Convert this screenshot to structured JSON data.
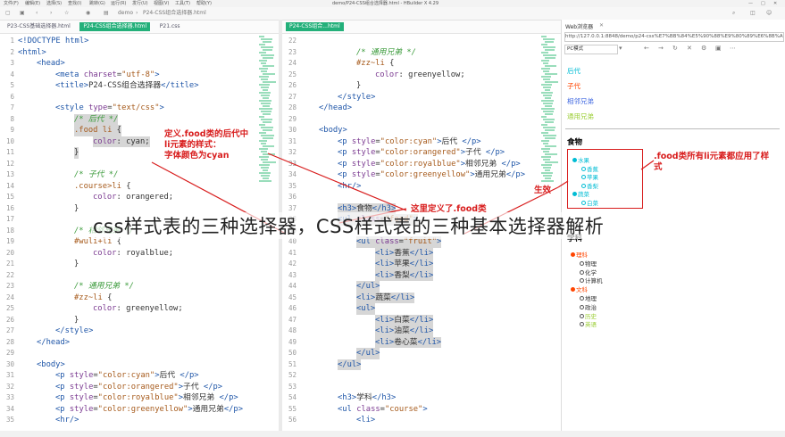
{
  "window": {
    "menu": [
      "文件(F)",
      "编辑(E)",
      "选择(S)",
      "查找(I)",
      "跳转(G)",
      "运行(R)",
      "发行(U)",
      "视图(V)",
      "工具(T)",
      "帮助(Y)"
    ],
    "title": "demo/P24-CSS组合选择器.html - HBuilder X 4.29"
  },
  "toolbar": {
    "breadcrumb_root": "demo",
    "breadcrumb_file": "P24-CSS组合选择器.html"
  },
  "tabs_left": [
    {
      "label": "P23-CSS基础选择器.html",
      "active": false
    },
    {
      "label": "P24-CSS组合选择器.html",
      "active": true
    },
    {
      "label": "P21.css",
      "active": false
    }
  ],
  "tabs_right": [
    {
      "label": "P24-CSS组合...html",
      "active": true
    }
  ],
  "left_code": [
    {
      "n": "1",
      "html": "<span class=\"tg\">&lt;!DOCTYPE html&gt;</span>",
      "ind": 0
    },
    {
      "n": "2",
      "html": "<span class=\"tg\">&lt;html&gt;</span>",
      "ind": 0
    },
    {
      "n": "3",
      "html": "<span class=\"tg\">&lt;head&gt;</span>",
      "ind": 1
    },
    {
      "n": "4",
      "html": "<span class=\"tg\">&lt;meta</span> <span class=\"at\">charset</span>=<span class=\"sv\">\"utf-8\"</span><span class=\"tg\">&gt;</span>",
      "ind": 2
    },
    {
      "n": "5",
      "html": "<span class=\"tg\">&lt;title&gt;</span>P24-CSS组合选择器<span class=\"tg\">&lt;/title&gt;</span>",
      "ind": 2
    },
    {
      "n": "6",
      "html": "",
      "ind": 0
    },
    {
      "n": "7",
      "html": "<span class=\"tg\">&lt;style</span> <span class=\"at\">type</span>=<span class=\"sv\">\"text/css\"</span><span class=\"tg\">&gt;</span>",
      "ind": 2
    },
    {
      "n": "8",
      "html": "<span class=\"cm\">/* 后代 */</span>",
      "ind": 3
    },
    {
      "n": "9",
      "html": "<span class=\"sv\">.food li</span> {",
      "ind": 3
    },
    {
      "n": "10",
      "html": "<span class=\"at\">color</span>: cyan;",
      "ind": 4
    },
    {
      "n": "11",
      "html": "}",
      "ind": 3
    },
    {
      "n": "12",
      "html": "",
      "ind": 0
    },
    {
      "n": "13",
      "html": "<span class=\"cm\">/* 子代 */</span>",
      "ind": 3
    },
    {
      "n": "14",
      "html": "<span class=\"sv\">.course&gt;li</span> {",
      "ind": 3
    },
    {
      "n": "15",
      "html": "<span class=\"at\">color</span>: orangered;",
      "ind": 4
    },
    {
      "n": "16",
      "html": "}",
      "ind": 3
    },
    {
      "n": "17",
      "html": "",
      "ind": 0
    },
    {
      "n": "18",
      "html": "<span class=\"cm\">/* 相邻兄弟 */</span>",
      "ind": 3
    },
    {
      "n": "19",
      "html": "<span class=\"sv\">#wuli+li</span> {",
      "ind": 3
    },
    {
      "n": "20",
      "html": "<span class=\"at\">color</span>: royalblue;",
      "ind": 4
    },
    {
      "n": "21",
      "html": "}",
      "ind": 3
    },
    {
      "n": "22",
      "html": "",
      "ind": 0
    },
    {
      "n": "23",
      "html": "<span class=\"cm\">/* 通用兄弟 */</span>",
      "ind": 3
    },
    {
      "n": "24",
      "html": "<span class=\"sv\">#zz~li</span> {",
      "ind": 3
    },
    {
      "n": "25",
      "html": "<span class=\"at\">color</span>: greenyellow;",
      "ind": 4
    },
    {
      "n": "26",
      "html": "}",
      "ind": 3
    },
    {
      "n": "27",
      "html": "<span class=\"tg\">&lt;/style&gt;</span>",
      "ind": 2
    },
    {
      "n": "28",
      "html": "<span class=\"tg\">&lt;/head&gt;</span>",
      "ind": 1
    },
    {
      "n": "29",
      "html": "",
      "ind": 0
    },
    {
      "n": "30",
      "html": "<span class=\"tg\">&lt;body&gt;</span>",
      "ind": 1
    },
    {
      "n": "31",
      "html": "<span class=\"tg\">&lt;p</span> <span class=\"at\">style</span>=<span class=\"sv\">\"color:cyan\"</span><span class=\"tg\">&gt;</span>后代 <span class=\"tg\">&lt;/p&gt;</span>",
      "ind": 2
    },
    {
      "n": "32",
      "html": "<span class=\"tg\">&lt;p</span> <span class=\"at\">style</span>=<span class=\"sv\">\"color:orangered\"</span><span class=\"tg\">&gt;</span>子代 <span class=\"tg\">&lt;/p&gt;</span>",
      "ind": 2
    },
    {
      "n": "33",
      "html": "<span class=\"tg\">&lt;p</span> <span class=\"at\">style</span>=<span class=\"sv\">\"color:royalblue\"</span><span class=\"tg\">&gt;</span>相邻兄弟 <span class=\"tg\">&lt;/p&gt;</span>",
      "ind": 2
    },
    {
      "n": "34",
      "html": "<span class=\"tg\">&lt;p</span> <span class=\"at\">style</span>=<span class=\"sv\">\"color:greenyellow\"</span><span class=\"tg\">&gt;</span>通用兄弟<span class=\"tg\">&lt;/p&gt;</span>",
      "ind": 2
    },
    {
      "n": "35",
      "html": "<span class=\"tg\">&lt;hr/&gt;</span>",
      "ind": 2
    }
  ],
  "right_code": [
    {
      "n": "22",
      "html": "",
      "ind": 0
    },
    {
      "n": "23",
      "html": "<span class=\"cm\">/* 通用兄弟 */</span>",
      "ind": 3
    },
    {
      "n": "24",
      "html": "<span class=\"sv\">#zz~li</span> {",
      "ind": 3
    },
    {
      "n": "25",
      "html": "<span class=\"at\">color</span>: greenyellow;",
      "ind": 4
    },
    {
      "n": "26",
      "html": "}",
      "ind": 3
    },
    {
      "n": "27",
      "html": "<span class=\"tg\">&lt;/style&gt;</span>",
      "ind": 2
    },
    {
      "n": "28",
      "html": "<span class=\"tg\">&lt;/head&gt;</span>",
      "ind": 1
    },
    {
      "n": "29",
      "html": "",
      "ind": 0
    },
    {
      "n": "30",
      "html": "<span class=\"tg\">&lt;body&gt;</span>",
      "ind": 1
    },
    {
      "n": "31",
      "html": "<span class=\"tg\">&lt;p</span> <span class=\"at\">style</span>=<span class=\"sv\">\"color:cyan\"</span><span class=\"tg\">&gt;</span>后代 <span class=\"tg\">&lt;/p&gt;</span>",
      "ind": 2
    },
    {
      "n": "32",
      "html": "<span class=\"tg\">&lt;p</span> <span class=\"at\">style</span>=<span class=\"sv\">\"color:orangered\"</span><span class=\"tg\">&gt;</span>子代 <span class=\"tg\">&lt;/p&gt;</span>",
      "ind": 2
    },
    {
      "n": "33",
      "html": "<span class=\"tg\">&lt;p</span> <span class=\"at\">style</span>=<span class=\"sv\">\"color:royalblue\"</span><span class=\"tg\">&gt;</span>相邻兄弟 <span class=\"tg\">&lt;/p&gt;</span>",
      "ind": 2
    },
    {
      "n": "34",
      "html": "<span class=\"tg\">&lt;p</span> <span class=\"at\">style</span>=<span class=\"sv\">\"color:greenyellow\"</span><span class=\"tg\">&gt;</span>通用兄弟<span class=\"tg\">&lt;/p&gt;</span>",
      "ind": 2
    },
    {
      "n": "35",
      "html": "<span class=\"tg\">&lt;hr/&gt;</span>",
      "ind": 2
    },
    {
      "n": "36",
      "html": "",
      "ind": 0
    },
    {
      "n": "37",
      "html": "<span class=\"tg\">&lt;h3&gt;</span>食物<span class=\"tg\">&lt;/h3&gt;</span>",
      "ind": 2
    },
    {
      "n": "38",
      "html": "<span class=\"tg\">&lt;ul</span> <span class=\"at\">class</span>=<span class=\"sv\">\"food\"</span><span class=\"tg\">&gt;</span>",
      "ind": 2
    },
    {
      "n": "39",
      "html": "",
      "ind": 0
    },
    {
      "n": "40",
      "html": "<span class=\"tg\">&lt;ul</span> <span class=\"at\">class</span>=<span class=\"sv\">\"fruit\"</span><span class=\"tg\">&gt;</span>",
      "ind": 3
    },
    {
      "n": "41",
      "html": "<span class=\"tg\">&lt;li&gt;</span>香蕉<span class=\"tg\">&lt;/li&gt;</span>",
      "ind": 4
    },
    {
      "n": "42",
      "html": "<span class=\"tg\">&lt;li&gt;</span>苹果<span class=\"tg\">&lt;/li&gt;</span>",
      "ind": 4
    },
    {
      "n": "43",
      "html": "<span class=\"tg\">&lt;li&gt;</span>香梨<span class=\"tg\">&lt;/li&gt;</span>",
      "ind": 4
    },
    {
      "n": "44",
      "html": "<span class=\"tg\">&lt;/ul&gt;</span>",
      "ind": 3
    },
    {
      "n": "45",
      "html": "<span class=\"tg\">&lt;li&gt;</span>蔬菜<span class=\"tg\">&lt;/li&gt;</span>",
      "ind": 3
    },
    {
      "n": "46",
      "html": "<span class=\"tg\">&lt;ul&gt;</span>",
      "ind": 3
    },
    {
      "n": "47",
      "html": "<span class=\"tg\">&lt;li&gt;</span>白菜<span class=\"tg\">&lt;/li&gt;</span>",
      "ind": 4
    },
    {
      "n": "48",
      "html": "<span class=\"tg\">&lt;li&gt;</span>油菜<span class=\"tg\">&lt;/li&gt;</span>",
      "ind": 4
    },
    {
      "n": "49",
      "html": "<span class=\"tg\">&lt;li&gt;</span>卷心菜<span class=\"tg\">&lt;/li&gt;</span>",
      "ind": 4
    },
    {
      "n": "50",
      "html": "<span class=\"tg\">&lt;/ul&gt;</span>",
      "ind": 3
    },
    {
      "n": "51",
      "html": "<span class=\"tg\">&lt;/ul&gt;</span>",
      "ind": 2
    },
    {
      "n": "52",
      "html": "",
      "ind": 0
    },
    {
      "n": "53",
      "html": "",
      "ind": 0
    },
    {
      "n": "54",
      "html": "<span class=\"tg\">&lt;h3&gt;</span>学科<span class=\"tg\">&lt;/h3&gt;</span>",
      "ind": 2
    },
    {
      "n": "55",
      "html": "<span class=\"tg\">&lt;ul</span> <span class=\"at\">class</span>=<span class=\"sv\">\"course\"</span><span class=\"tg\">&gt;</span>",
      "ind": 2
    },
    {
      "n": "56",
      "html": "<span class=\"tg\">&lt;li&gt;</span>",
      "ind": 3
    }
  ],
  "browser": {
    "tab_label": "Web浏览器",
    "url": "http://127.0.0.1:8848/demo/p24-css%E7%BB%84%E5%90%88%E9%80%89%E6%8B%A9%E5%99%A8.html",
    "mode": "PC模式",
    "paras": [
      {
        "text": "后代",
        "color": "#00bcd4"
      },
      {
        "text": "子代",
        "color": "#ff4500"
      },
      {
        "text": "相邻兄弟",
        "color": "#4169e1"
      },
      {
        "text": "通用兄弟",
        "color": "#9acd32"
      }
    ],
    "food_heading": "食物",
    "food_items": [
      {
        "text": "水果",
        "level": 0
      },
      {
        "text": "香蕉",
        "level": 1
      },
      {
        "text": "苹果",
        "level": 1
      },
      {
        "text": "香梨",
        "level": 1
      },
      {
        "text": "蔬菜",
        "level": 0
      },
      {
        "text": "白菜",
        "level": 1
      }
    ],
    "course_heading": "学科",
    "course_items": [
      {
        "text": "理科",
        "level": 0,
        "color": "#ff4500"
      },
      {
        "text": "物理",
        "level": 1,
        "color": "#333"
      },
      {
        "text": "化学",
        "level": 1,
        "color": "#333"
      },
      {
        "text": "计算机",
        "level": 1,
        "color": "#333"
      },
      {
        "text": "文科",
        "level": 0,
        "color": "#ff4500"
      },
      {
        "text": "地理",
        "level": 1,
        "color": "#333"
      },
      {
        "text": "政治",
        "level": 1,
        "color": "#333"
      },
      {
        "text": "历史",
        "level": 1,
        "color": "#9acd32"
      },
      {
        "text": "英语",
        "level": 1,
        "color": "#9acd32"
      }
    ]
  },
  "annotations": {
    "left_note": "定义.food类的后代中\nli元素的样式：\n字体颜色为cyan",
    "effect_note": "生效",
    "define_note": "这里定义了.food类",
    "right_note": ".food类所有li元素都应用了样\n式"
  },
  "caption": "css样式表的三种选择器，CSS样式表的三种基本选择器解析",
  "colors": {
    "accent": "#23b07a",
    "annotation": "#d81c1c"
  }
}
